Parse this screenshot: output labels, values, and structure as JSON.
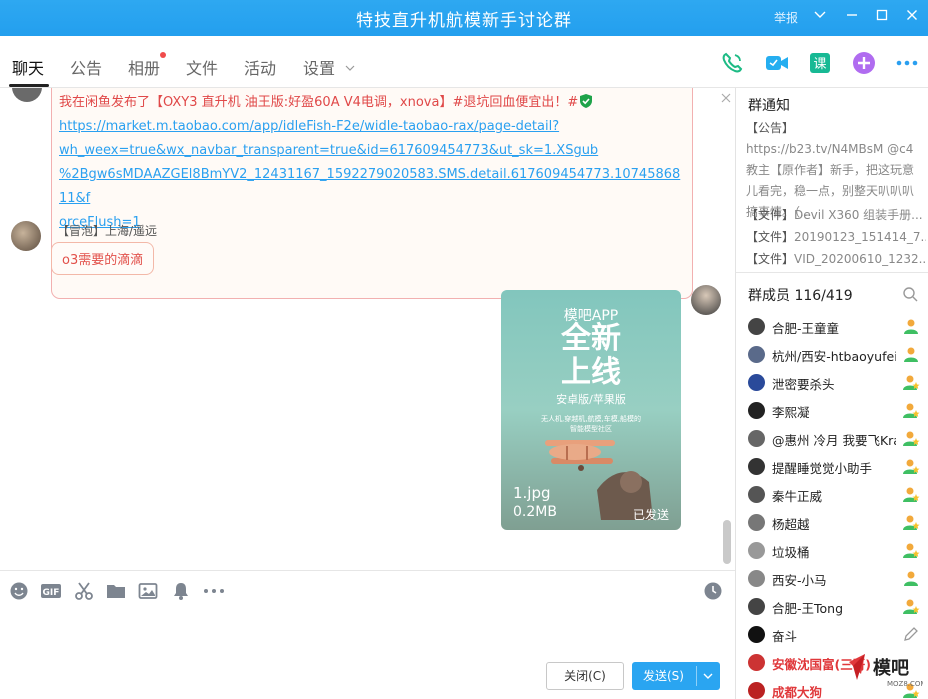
{
  "window": {
    "title": "特技直升机航模新手讨论群",
    "report_label": "举报",
    "controls": [
      "chevron-down-icon",
      "minimize-icon",
      "maximize-icon",
      "close-icon"
    ]
  },
  "tabs": [
    {
      "label": "聊天",
      "active": true
    },
    {
      "label": "公告"
    },
    {
      "label": "相册",
      "dot": true
    },
    {
      "label": "文件"
    },
    {
      "label": "活动"
    },
    {
      "label": "设置"
    }
  ],
  "toolbar_icons": [
    "phone-icon",
    "video-icon",
    "course-icon",
    "add-app-icon",
    "more-icon"
  ],
  "chat": {
    "message1": {
      "text": "我在闲鱼发布了【OXY3 直升机 油王版:好盈60A V4电调，xnova】#退坑回血便宜出！#",
      "link_lines": [
        "https://market.m.taobao.com/app/idleFish-F2e/widle-taobao-rax/page-detail?",
        "wh_weex=true&wx_navbar_transparent=true&id=617609454773&ut_sk=1.XSgub",
        "%2Bgw6sMDAAZGEl8BmYV2_12431167_1592279020583.SMS.detail.617609454773.1074586811&f",
        "orceFlush=1"
      ]
    },
    "message2": {
      "sender": "【冒泡】上海/遥远",
      "text": "o3需要的滴滴"
    },
    "image_message": {
      "line1": "模吧APP",
      "line2": "全新",
      "line3": "上线",
      "line4": "安卓版/苹果版",
      "line5": "无人机,穿越机,航模,车模,船模的\n智能模型社区",
      "file_name": "1.jpg",
      "file_size": "0.2MB",
      "status": "已发送"
    }
  },
  "input_toolbar_icons": [
    "emoji-icon",
    "gif-icon",
    "scissors-icon",
    "folder-icon",
    "image-icon",
    "bell-icon",
    "more-icon",
    "history-clock-icon"
  ],
  "buttons": {
    "close": "关闭(C)",
    "send": "发送(S)"
  },
  "sidebar": {
    "notice_title": "群通知",
    "notice_text": {
      "tag": "【公告】",
      "body": "https://b23.tv/N4MBsM @c4教主【原作者】新手，把这玩意儿看完，稳一点，别整天叭叭叭搞事情。（..."
    },
    "files": [
      {
        "tag": "【文件】",
        "name": "Devil X360 组装手册..."
      },
      {
        "tag": "【文件】",
        "name": "20190123_151414_7..."
      },
      {
        "tag": "【文件】",
        "name": "VID_20200610_1232..."
      }
    ],
    "members_title": "群成员 116/419",
    "members": [
      {
        "name": "合肥-王童童",
        "badge": "admin-icon"
      },
      {
        "name": "杭州/西安-htbaoyufei",
        "badge": "admin-icon"
      },
      {
        "name": "泄密要杀头",
        "badge": "star-member-icon"
      },
      {
        "name": "李熙凝",
        "badge": "star-member-icon"
      },
      {
        "name": "@惠州 冷月 我要飞Kra",
        "badge": "star-member-icon"
      },
      {
        "name": "提醒睡觉觉小助手",
        "badge": "star-member-icon"
      },
      {
        "name": "秦牛正威",
        "badge": "star-member-icon"
      },
      {
        "name": "杨超越",
        "badge": "star-member-icon"
      },
      {
        "name": "垃圾桶",
        "badge": "star-member-icon"
      },
      {
        "name": "西安-小马",
        "badge": "admin-icon"
      },
      {
        "name": "合肥-王Tong",
        "badge": "star-member-icon"
      },
      {
        "name": "奋斗",
        "badge": "edit-icon"
      },
      {
        "name": "安徽沈国富(三哥)",
        "badge": "",
        "red": true
      },
      {
        "name": "成都大狗",
        "badge": "star-member-icon",
        "red": true
      }
    ]
  },
  "colors": {
    "title_bar": "#239fee",
    "link": "#2aa0f0",
    "send_button": "#2aa5f1",
    "red_text": "#e04848"
  }
}
